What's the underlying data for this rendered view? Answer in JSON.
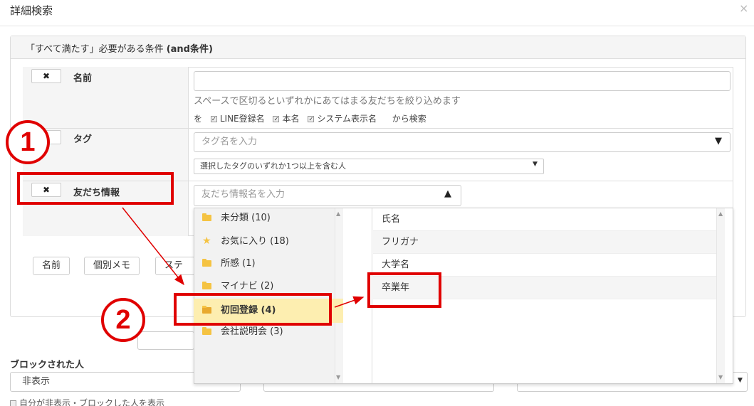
{
  "dialog": {
    "title": "詳細検索",
    "close_icon": "×"
  },
  "panel": {
    "heading_prefix": "「すべて満たす」必要がある条件 ",
    "heading_bold": "(and条件)"
  },
  "rows": {
    "name": {
      "remove_icon": "✖",
      "label": "名前",
      "hint": "スペースで区切るといずれかにあてはまる友だちを絞り込めます",
      "search_prefix": "を",
      "options": [
        "LINE登録名",
        "本名",
        "システム表示名"
      ],
      "search_suffix": "から検索"
    },
    "tag": {
      "label": "タグ",
      "placeholder": "タグ名を入力",
      "match_select": "選択したタグのいずれか1つ以上を含む人"
    },
    "friend_info": {
      "remove_icon": "✖",
      "label": "友だち情報",
      "placeholder": "友だち情報名を入力"
    }
  },
  "add_buttons": [
    "名前",
    "個別メモ",
    "ステ"
  ],
  "dropdown": {
    "categories": [
      {
        "label": "未分類 (10)",
        "icon": "folder-icon"
      },
      {
        "label": "お気に入り (18)",
        "icon": "star-icon"
      },
      {
        "label": "所感 (1)",
        "icon": "folder-icon"
      },
      {
        "label": "マイナビ (2)",
        "icon": "folder-icon"
      },
      {
        "label": "初回登録 (4)",
        "icon": "folder-open-icon",
        "selected": true
      },
      {
        "label": "会社説明会 (3)",
        "icon": "folder-icon"
      }
    ],
    "items": [
      "氏名",
      "フリガナ",
      "大学名",
      "卒業年"
    ]
  },
  "annotations": {
    "step1": "1",
    "step2": "2",
    "accent_color": "#e00000"
  },
  "blocked": {
    "label": "ブロックされた人",
    "select_value": "非表示",
    "self_hidden_label": "自分が非表示・ブロックした人を表示"
  }
}
